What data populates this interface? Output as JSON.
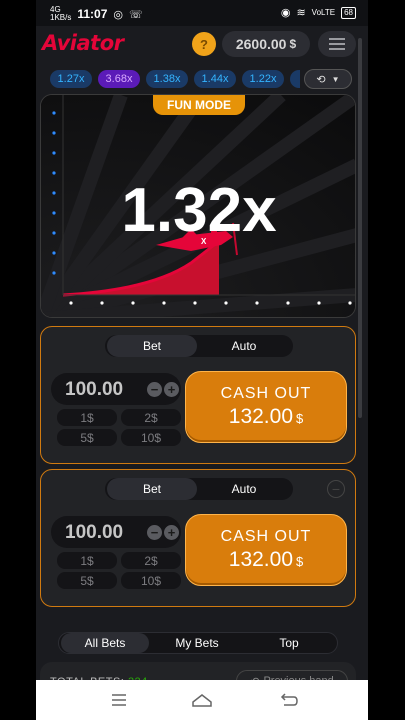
{
  "status_bar": {
    "network": "4G",
    "speed": "1KB/s",
    "time": "11:07",
    "signal_label": "VoLTE",
    "battery": "68"
  },
  "header": {
    "logo": "Aviator",
    "coin_symbol": "?",
    "balance": "2600.00",
    "currency": "$"
  },
  "history": {
    "multipliers": [
      "1.27x",
      "3.68x",
      "1.38x",
      "1.44x",
      "1.22x"
    ]
  },
  "game": {
    "mode_label": "FUN MODE",
    "multiplier": "1.32x"
  },
  "bet_panels": [
    {
      "tabs": [
        "Bet",
        "Auto"
      ],
      "amount": "100.00",
      "quick_amounts": [
        "1$",
        "2$",
        "5$",
        "10$"
      ],
      "cashout_label": "CASH OUT",
      "cashout_value": "132.00",
      "currency": "$"
    },
    {
      "tabs": [
        "Bet",
        "Auto"
      ],
      "amount": "100.00",
      "quick_amounts": [
        "1$",
        "2$",
        "5$",
        "10$"
      ],
      "cashout_label": "CASH OUT",
      "cashout_value": "132.00",
      "currency": "$"
    }
  ],
  "bets_list": {
    "tabs": [
      "All Bets",
      "My Bets",
      "Top"
    ],
    "total_label": "TOTAL BETS:",
    "total_value": "324",
    "previous_hand": "Previous hand"
  },
  "colors": {
    "brand_red": "#e50539",
    "orange": "#d97d0c",
    "blue_pill": "#34b4ff",
    "purple_pill": "#5b1bb8"
  }
}
